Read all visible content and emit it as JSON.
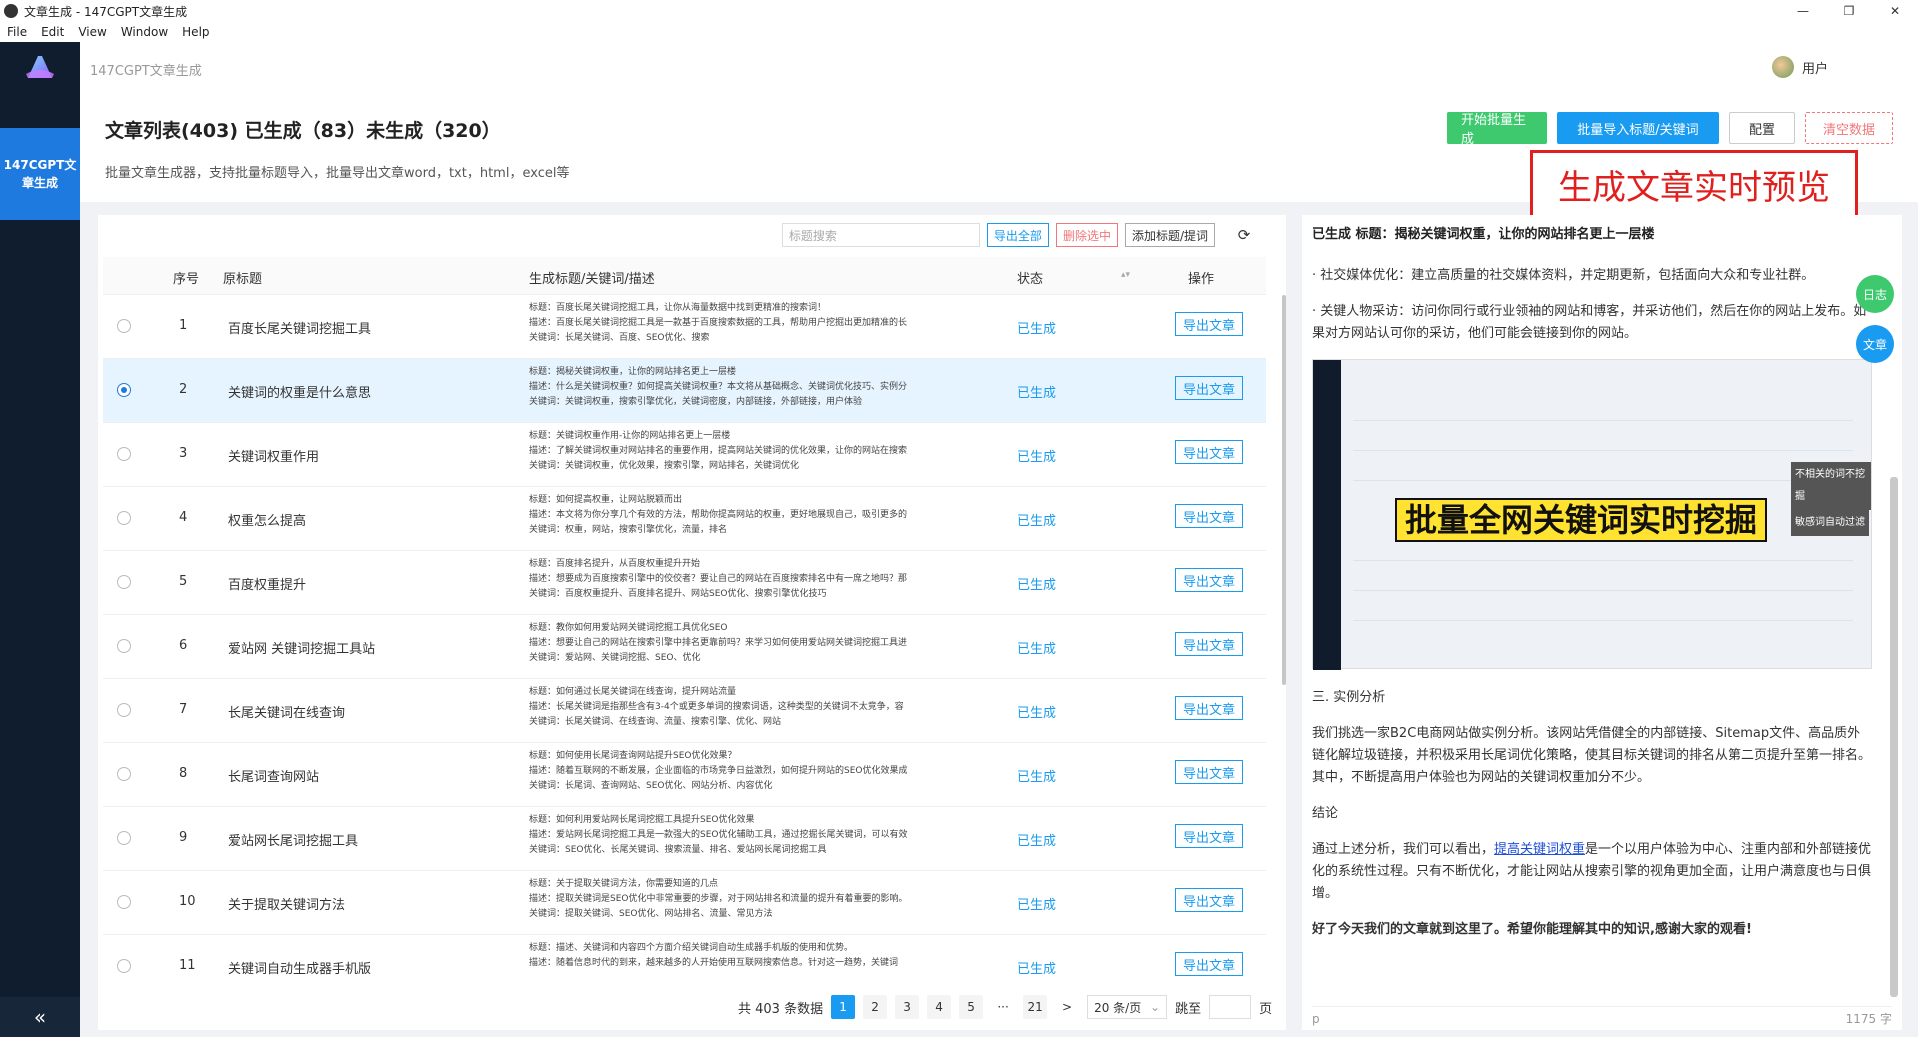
{
  "window": {
    "title": "文章生成 - 147CGPT文章生成",
    "controls": {
      "minimize": "—",
      "maximize": "❐",
      "close": "✕"
    }
  },
  "menu": [
    "File",
    "Edit",
    "View",
    "Window",
    "Help"
  ],
  "sidebar": {
    "logo_icon": "app-logo-icon",
    "active_item": "147CGPT文章生成",
    "collapse": "«"
  },
  "topbar": {
    "app_name": "147CGPT文章生成",
    "user_label": "用户"
  },
  "header": {
    "title": "文章列表(403) 已生成（83）未生成（320）",
    "subtitle": "批量文章生成器，支持批量标题导入，批量导出文章word，txt，html，excel等",
    "buttons": {
      "start": "开始批量生成",
      "import": "批量导入标题/关键词",
      "config": "配置",
      "clear": "清空数据"
    }
  },
  "banner": "生成文章实时预览",
  "toolbar": {
    "search_placeholder": "标题搜索",
    "export_all": "导出全部",
    "delete_selected": "删除选中",
    "add_title": "添加标题/提词",
    "refresh_icon": "refresh-icon"
  },
  "table": {
    "headers": [
      "序号",
      "原标题",
      "生成标题/关键词/描述",
      "状态",
      "操作"
    ],
    "sort_icon": "sort-icon",
    "rows": [
      {
        "num": "1",
        "title": "百度长尾关键词挖掘工具",
        "desc": [
          "标题：百度长尾关键词挖掘工具，让你从海量数据中找到更精准的搜索词！",
          "描述：百度长尾关键词挖掘工具是一款基于百度搜索数据的工具，帮助用户挖掘出更加精准的长",
          "关键词：长尾关键词、百度、SEO优化、搜索"
        ],
        "status": "已生成",
        "action": "导出文章",
        "selected": false
      },
      {
        "num": "2",
        "title": "关键词的权重是什么意思",
        "desc": [
          "标题：揭秘关键词权重，让你的网站排名更上一层楼",
          "描述：什么是关键词权重？如何提高关键词权重？本文将从基础概念、关键词优化技巧、实例分",
          "关键词：关键词权重，搜索引擎优化，关键词密度，内部链接，外部链接，用户体验"
        ],
        "status": "已生成",
        "action": "导出文章",
        "selected": true
      },
      {
        "num": "3",
        "title": "关键词权重作用",
        "desc": [
          "标题：关键词权重作用-让你的网站排名更上一层楼",
          "描述：了解关键词权重对网站排名的重要作用，提高网站关键词的优化效果，让你的网站在搜索",
          "关键词：关键词权重，优化效果，搜索引擎，网站排名，关键词优化"
        ],
        "status": "已生成",
        "action": "导出文章",
        "selected": false
      },
      {
        "num": "4",
        "title": "权重怎么提高",
        "desc": [
          "标题：如何提高权重，让网站脱颖而出",
          "描述：本文将为你分享几个有效的方法，帮助你提高网站的权重，更好地展现自己，吸引更多的",
          "关键词：权重，网站，搜索引擎优化，流量，排名"
        ],
        "status": "已生成",
        "action": "导出文章",
        "selected": false
      },
      {
        "num": "5",
        "title": "百度权重提升",
        "desc": [
          "标题：百度排名提升，从百度权重提升开始",
          "描述：想要成为百度搜索引擎中的佼佼者？要让自己的网站在百度搜索排名中有一席之地吗？那",
          "关键词：百度权重提升、百度排名提升、网站SEO优化、搜索引擎优化技巧"
        ],
        "status": "已生成",
        "action": "导出文章",
        "selected": false
      },
      {
        "num": "6",
        "title": "爱站网 关键词挖掘工具站",
        "desc": [
          "标题：教你如何用爱站网关键词挖掘工具优化SEO",
          "描述：想要让自己的网站在搜索引擎中排名更靠前吗？来学习如何使用爱站网关键词挖掘工具进",
          "关键词：爱站网、关键词挖掘、SEO、优化"
        ],
        "status": "已生成",
        "action": "导出文章",
        "selected": false
      },
      {
        "num": "7",
        "title": "长尾关键词在线查询",
        "desc": [
          "标题：如何通过长尾关键词在线查询，提升网站流量",
          "描述：长尾关键词是指那些含有3-4个或更多单词的搜索词语，这种类型的关键词不太竞争，容",
          "关键词：长尾关键词、在线查询、流量、搜索引擎、优化、网站"
        ],
        "status": "已生成",
        "action": "导出文章",
        "selected": false
      },
      {
        "num": "8",
        "title": "长尾词查询网站",
        "desc": [
          "标题：如何使用长尾词查询网站提升SEO优化效果？",
          "描述：随着互联网的不断发展，企业面临的市场竞争日益激烈，如何提升网站的SEO优化效果成",
          "关键词：长尾词、查询网站、SEO优化、网站分析、内容优化"
        ],
        "status": "已生成",
        "action": "导出文章",
        "selected": false
      },
      {
        "num": "9",
        "title": "爱站网长尾词挖掘工具",
        "desc": [
          "标题：如何利用爱站网长尾词挖掘工具提升SEO优化效果",
          "描述：爱站网长尾词挖掘工具是一款强大的SEO优化辅助工具，通过挖掘长尾关键词，可以有效",
          "关键词：SEO优化、长尾关键词、搜索流量、排名、爱站网长尾词挖掘工具"
        ],
        "status": "已生成",
        "action": "导出文章",
        "selected": false
      },
      {
        "num": "10",
        "title": "关于提取关键词方法",
        "desc": [
          "标题：关于提取关键词方法，你需要知道的几点",
          "描述：提取关键词是SEO优化中非常重要的步骤，对于网站排名和流量的提升有着重要的影响。",
          "关键词：提取关键词、SEO优化、网站排名、流量、常见方法"
        ],
        "status": "已生成",
        "action": "导出文章",
        "selected": false
      },
      {
        "num": "11",
        "title": "关键词自动生成器手机版",
        "desc": [
          "标题：描述、关键词和内容四个方面介绍关键词自动生成器手机版的使用和优势。",
          "描述：随着信息时代的到来，越来越多的人开始使用互联网搜索信息。针对这一趋势，关键词",
          ""
        ],
        "status": "已生成",
        "action": "导出文章",
        "selected": false
      }
    ]
  },
  "pagination": {
    "total": "共 403 条数据",
    "pages": [
      "1",
      "2",
      "3",
      "4",
      "5",
      "···",
      "21"
    ],
    "next": ">",
    "size": "20 条/页",
    "size_arrow": "⌄",
    "jump": "跳至",
    "page_unit": "页"
  },
  "preview": {
    "title": "已生成 标题：揭秘关键词权重，让你的网站排名更上一层楼",
    "p1": "· 社交媒体优化：建立高质量的社交媒体资料，并定期更新，包括面向大众和专业社群。",
    "p2": "· 关键人物采访：访问你同行或行业领袖的网站和博客，并采访他们，然后在你的网站上发布。如果对方网站认可你的采访，他们可能会链接到你的网站。",
    "image_caption": "批量全网关键词实时挖掘",
    "image_tag1": "不相关的词不挖掘",
    "image_tag2": "敏感词自动过滤",
    "section": "三. 实例分析",
    "p3": "我们挑选一家B2C电商网站做实例分析。该网站凭借健全的内部链接、Sitemap文件、高品质外链化解垃圾链接，并积极采用长尾词优化策略，使其目标关键词的排名从第二页提升至第一排名。其中，不断提高用户体验也为网站的关键词权重加分不少。",
    "conclusion_heading": "结论",
    "p4_link": "提高关键词权重",
    "p4_pre": "通过上述分析，我们可以看出，",
    "p4_post": "是一个以用户体验为中心、注重内部和外部链接优化的系统性过程。只有不断优化，才能让网站从搜索引擎的视角更加全面，让用户满意度也与日俱增。",
    "closing": "好了今天我们的文章就到这里了。希望你能理解其中的知识,感谢大家的观看!",
    "footer_left": "p",
    "footer_right": "1175 字"
  },
  "float": {
    "log": "日志",
    "article": "文章"
  }
}
